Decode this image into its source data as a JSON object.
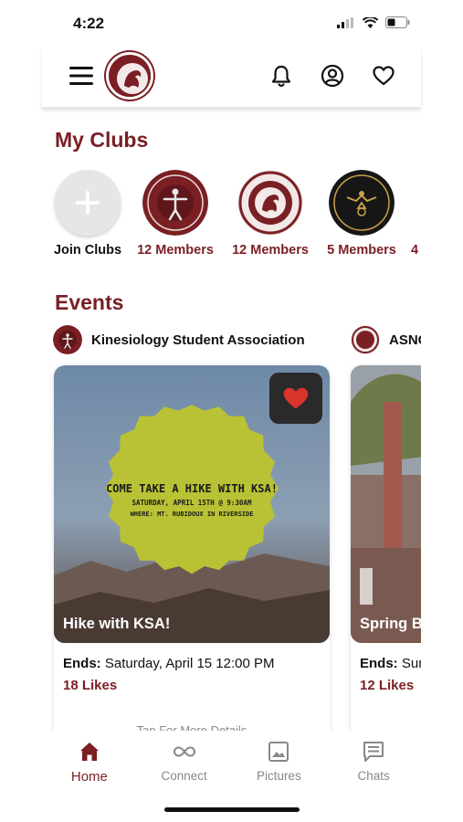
{
  "status": {
    "time": "4:22"
  },
  "sections": {
    "clubs_title": "My Clubs",
    "events_title": "Events"
  },
  "clubs": [
    {
      "label": "Join Clubs",
      "kind": "join"
    },
    {
      "label": "12 Members",
      "kind": "club"
    },
    {
      "label": "12 Members",
      "kind": "club"
    },
    {
      "label": "5 Members",
      "kind": "club"
    },
    {
      "label": "4",
      "kind": "club"
    }
  ],
  "events": [
    {
      "org": "Kinesiology Student Association",
      "title": "Hike with KSA!",
      "ends_label": "Ends:",
      "ends_value": "Saturday, April 15 12:00 PM",
      "likes": "18 Likes",
      "more": "Tap For More Details",
      "poster_line1": "COME TAKE A HIKE WITH KSA!",
      "poster_line2": "SATURDAY, APRIL 15TH @ 9:30AM",
      "poster_line3": "WHERE: MT. RUBIDOUX IN RIVERSIDE"
    },
    {
      "org": "ASNC",
      "title": "Spring B",
      "ends_label": "Ends:",
      "ends_value": "Sun",
      "likes": "12 Likes"
    }
  ],
  "nav": {
    "home": "Home",
    "connect": "Connect",
    "pictures": "Pictures",
    "chats": "Chats"
  },
  "colors": {
    "brand": "#7a1f24",
    "muted": "#888888",
    "poster": "#b9c234"
  }
}
